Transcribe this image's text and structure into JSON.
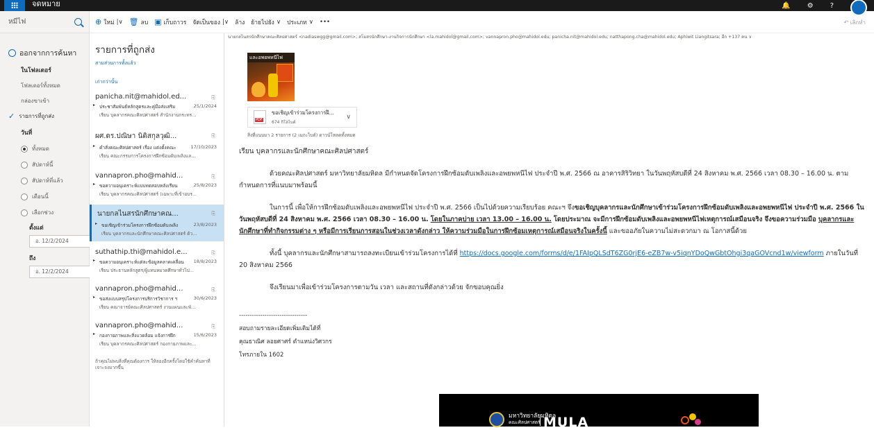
{
  "app": {
    "title": "จดหมาย"
  },
  "left_pane": {
    "search_placeholder": "หมีไฟ",
    "expand_label": "ออกจากการค้นหา",
    "in_folder": "ในโฟลเดอร์",
    "folders": [
      "โฟลเดอร์ทั้งหมด",
      "กล่องขาเข้า"
    ],
    "selected_folder": "รายการที่ถูกส่ง",
    "date_group": "วันที่",
    "date_options": [
      {
        "label": "ทั้งหมด",
        "selected": true
      },
      {
        "label": "สัปดาห์นี้",
        "selected": false
      },
      {
        "label": "สัปดาห์ที่แล้ว",
        "selected": false
      },
      {
        "label": "เดือนนี้",
        "selected": false
      },
      {
        "label": "เลือกช่วง",
        "selected": false
      }
    ],
    "start_label": "ตั้งแต่",
    "start_value": "อ. 12/2/2024",
    "end_label": "ถึง",
    "end_value": "อ. 12/2/2024"
  },
  "command_bar": {
    "new": "ใหม่",
    "delete": "ลบ",
    "archive": "เก็บถาวร",
    "categorize": "จัดเป็นของ",
    "sweep": "ล้าง",
    "move": "ย้ายไปยัง",
    "categories": "ประเภท",
    "more": "•••",
    "undo": "เลิกทำ"
  },
  "message_list": {
    "title": "รายการที่ถูกส่ง",
    "filter": "สามส่วนการทั้งแล้ว",
    "section": "เก่ากว่านั้น",
    "messages": [
      {
        "from": "panicha.nit@mahidol.ed...",
        "subject": "ประชาสัมพันธ์หลักสูตรและคู่มือส่งเสริม",
        "date": "25/1/2024",
        "preview": "เรียน บุคลากรคณะศิลปศาสตร์ สำนักงานกระทร...",
        "attach": true,
        "selected": false
      },
      {
        "from": "ผศ.ดร.ปณิษา นิติสกุลวุฒิ...",
        "subject": "คำสั่งคณะศิลปศาสตร์ เรื่อง แต่งตั้งคณะ",
        "date": "17/10/2023",
        "preview": "เรียน คณะกรรมการโครงการฝึกซ้อมดับเพลิงแล...",
        "attach": true,
        "selected": false
      },
      {
        "from": "vannapron.pho@mahid...",
        "subject": "ขอความอนุเคราะห์แบบทดสอบหลังเรียน",
        "date": "25/8/2023",
        "preview": "เรียน บุคลากรคณะศิลปศาสตร์ (เฉพาะที่เข้าอบร...",
        "attach": true,
        "selected": false
      },
      {
        "from": "นายกลไนสรนักศึกษาคณ...",
        "subject": "ขอเชิญเข้าร่วมโครงการฝึกซ้อมดับเพลิง",
        "date": "23/8/2023",
        "preview": "เรียน บุคลากรและนักศึกษาคณะศิลปศาสตร์ ด้ว...",
        "attach": true,
        "selected": true
      },
      {
        "from": "suthathip.thi@mahidol.e...",
        "subject": "ขอความอนุเคราะห์แต่ละข้อมูลคลาดเคลื่อน",
        "date": "18/8/2023",
        "preview": "เรียน ประธานหลักสูตร/ผู้แทนหมวดศึกษาทั่วไป...",
        "attach": true,
        "selected": false
      },
      {
        "from": "vannapron.pho@mahid...",
        "subject": "ขอส่งแบบสรุปโครงการบริการวิชาการ ฯ",
        "date": "30/6/2023",
        "preview": "เรียน คณาจารย์คณะศิลปศาสตร์ งานแผนและพั...",
        "attach": true,
        "selected": false
      },
      {
        "from": "vannapron.pho@mahid...",
        "subject": "กองกายภาพและสิ่งแวดล้อม แจ้งการฝึก",
        "date": "15/6/2023",
        "preview": "เรียน บุคลากรคณะศิลปศาสตร์ กองกายภาพและ...",
        "attach": true,
        "selected": false
      }
    ],
    "footer": "ถ้าคุณไม่พบสิ่งที่คุณต้องการ ให้ลองอีกครั้งโดยใช้คำค้นหาที่เจาะจงมากขึ้น"
  },
  "reading": {
    "recipients": "นายกลไนสรนักศึกษาคณะศิลปศาสตร์ <nadiaswgg@gmail.com>; สโมสรนักศึกษา-งานกิจการนักศึกษา <la.mahidol@gmail.com>; vannapron.pho@mahidol.edu; panicha.nit@mahidol.edu; natthapong.cha@mahidol.edu; Aphiwit Liangitsara; อีก +137 คน ∨",
    "poster_header": "และอพยพหนีไฟ",
    "attachment_name": "ขอเชิญเข้าร่วมโครงการฝึ...",
    "attachment_size": "674 กิโลไบต์",
    "attachment_info": "สิ่งที่แนบมา 2 รายการ (2 เมกะไบต์)   ดาวน์โหลดทั้งหมด",
    "greeting": "เรียน  บุคลากรและนักศึกษาคณะศิลปศาสตร์",
    "para1": "ด้วยคณะศิลปศาสตร์ มหาวิทยาลัยมหิดล มีกำหนดจัดโครงการฝึกซ้อมดับเพลิงและอพยพหนีไฟ ประจำปี พ.ศ. 2566 ณ อาคารสิริวิทยา  ในวันพฤหัสบดีที่ 24 สิงหาคม พ.ศ. 2566 เวลา 08.30 – 16.00 น. ตามกำหนดการที่แนบมาพร้อมนี้",
    "para2_a": "ในการนี้ เพื่อให้การฝึกซ้อมดับเพลิงและอพยพหนีไฟ ประจำปี พ.ศ. 2566 เป็นไปด้วยความเรียบร้อย คณะฯ จึง",
    "para2_b": "ขอเชิญบุคลากรและนักศึกษาเข้าร่วมโครงการฝึกซ้อมดับเพลิงและอพยพหนีไฟ ประจำปี พ.ศ. 2566 ในวันพฤหัสบดีที่ 24 สิงหาคม พ.ศ. 2566 เวลา 08.30 – 16.00 น.",
    "para2_c": "โดยในภาคบ่าย เวลา 13.00 – 16.00 น.",
    "para2_d": "โดยประมาณ จะมีการฝึกซ้อมดับเพลิงและอพยพหนีไฟเหตุการณ์เสมือนจริง จึงขอความร่วมมือ",
    "para2_e": "บุคลากรและนักศึกษาที่ทำกิจกรรมต่าง ๆ หรือมีการเรียนการสอนในช่วงเวลาดังกล่าว ให้ความร่วมมือในการฝึกซ้อมเหตุการณ์เสมือนจริงในครั้งนี้",
    "para2_f": " และขออภัยในความไม่สะดวกมา ณ โอกาสนี้ด้วย",
    "para3_a": "ทั้งนี้ บุคลากรและนักศึกษาสามารถลงทะเบียนเข้าร่วมโครงการได้ที่ ",
    "para3_link": "https://docs.google.com/forms/d/e/1FAIpQLSdT6ZG0rjE6-eZB7w-v5iqnYDoQwGbtOhgi3qaGOVcnd1w/viewform",
    "para3_b": " ภายในวันที่ 20 สิงหาคม 2566",
    "para4": "จึงเรียนมาเพื่อเข้าร่วมโครงการตามวัน เวลา และสถานที่ดังกล่าวด้วย จักขอบคุณยิ่ง",
    "sig_line": "--------------------------------",
    "sig1": "สอบถามรายละเอียดเพิ่มเติมได้ที่",
    "sig2": "คุณธาณิศ ลอยศาศร์ ตำแหน่งวิศวกร",
    "sig3": "โทรภายใน 1602",
    "banner_uni": "มหาวิทยาลัยมหิดล",
    "banner_uni2": "คณะศิลปศาสตร์",
    "banner_mula": "MULA"
  }
}
